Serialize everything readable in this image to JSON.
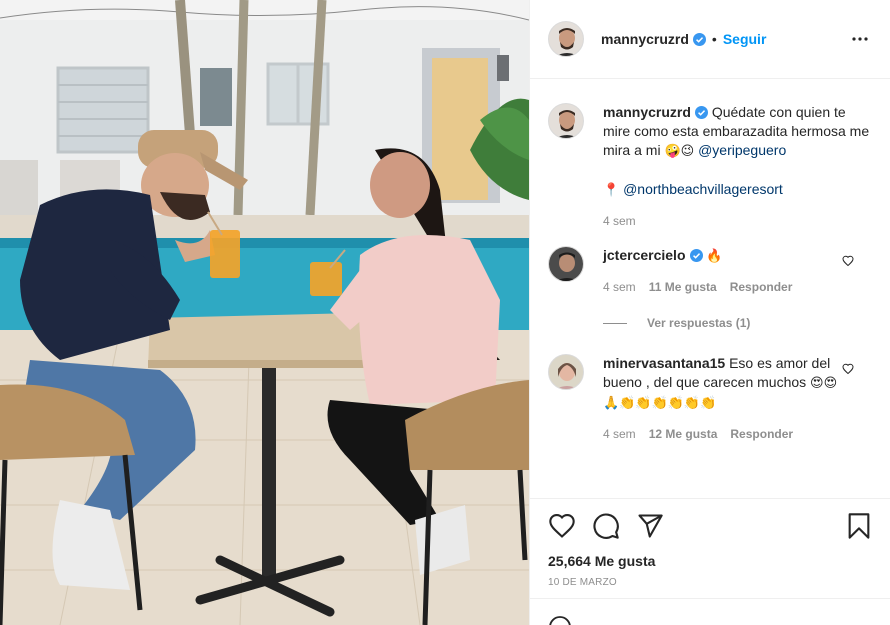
{
  "post": {
    "username": "mannycruzrd",
    "follow_label": "Seguir",
    "separator": "•"
  },
  "caption": {
    "username": "mannycruzrd",
    "text": "Quédate con quien te mire como esta embarazadita hermosa me mira a mi",
    "emojis": "🤪😉",
    "mention": "@yeripeguero",
    "location_pin": "📍",
    "location_mention": "@northbeachvillageresort",
    "time": "4 sem"
  },
  "comments": [
    {
      "username": "jctercercielo",
      "text": "",
      "emojis": "🔥",
      "time": "4 sem",
      "likes": "11 Me gusta",
      "reply_label": "Responder",
      "view_replies": "Ver respuestas (1)"
    },
    {
      "username": "minervasantana15",
      "text": "Eso es amor del bueno , del que carecen muchos",
      "emojis": "😍😍🙏👏👏👏👏👏👏",
      "time": "4 sem",
      "likes": "12 Me gusta",
      "reply_label": "Responder"
    }
  ],
  "likes_count": "25,664 Me gusta",
  "post_date": "10 DE MARZO",
  "icons": {
    "more": "more-options-icon",
    "like": "heart-icon",
    "comment": "comment-icon",
    "share": "share-icon",
    "save": "bookmark-icon",
    "verified": "verified-badge-icon"
  },
  "colors": {
    "link": "#0095f6",
    "mention": "#00376b",
    "secondary_text": "#8e8e8e",
    "primary_text": "#262626",
    "verified": "#3897f0"
  }
}
